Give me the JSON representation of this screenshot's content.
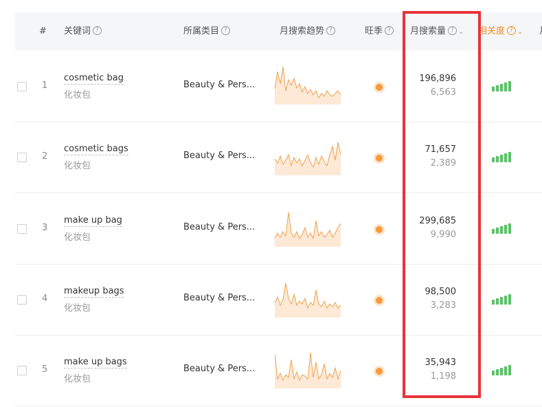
{
  "header": {
    "index": "#",
    "keyword": "关键词",
    "category": "所属类目",
    "trend": "月搜索趋势",
    "season": "旺季",
    "monthly_volume": "月搜索量",
    "relevance": "相关度",
    "next_col": "月",
    "help_icon": "?"
  },
  "rows": [
    {
      "index": "1",
      "keyword": "cosmetic bag",
      "keyword_cn": "化妆包",
      "category": "Beauty & Pers...",
      "volume": "196,896",
      "volume_sub": "6,563",
      "relevance_level": 5,
      "trend": [
        22,
        48,
        30,
        55,
        20,
        36,
        28,
        38,
        24,
        30,
        18,
        26,
        16,
        22,
        14,
        20,
        10,
        16,
        12,
        20,
        14,
        12,
        16,
        20,
        14
      ]
    },
    {
      "index": "2",
      "keyword": "cosmetic bags",
      "keyword_cn": "化妆包",
      "category": "Beauty & Pers...",
      "volume": "71,657",
      "volume_sub": "2,389",
      "relevance_level": 5,
      "trend": [
        24,
        18,
        28,
        16,
        22,
        30,
        14,
        26,
        18,
        24,
        14,
        22,
        30,
        18,
        12,
        26,
        16,
        28,
        20,
        14,
        30,
        42,
        22,
        48,
        30
      ]
    },
    {
      "index": "3",
      "keyword": "make up bag",
      "keyword_cn": "化妆包",
      "category": "Beauty & Pers...",
      "volume": "299,685",
      "volume_sub": "9,990",
      "relevance_level": 5,
      "trend": [
        12,
        20,
        14,
        22,
        16,
        50,
        20,
        14,
        22,
        12,
        18,
        28,
        14,
        20,
        12,
        38,
        16,
        22,
        14,
        18,
        24,
        14,
        20,
        28,
        34
      ]
    },
    {
      "index": "4",
      "keyword": "makeup bags",
      "keyword_cn": "化妆包",
      "category": "Beauty & Pers...",
      "volume": "98,500",
      "volume_sub": "3,283",
      "relevance_level": 5,
      "trend": [
        22,
        30,
        18,
        26,
        50,
        28,
        20,
        34,
        18,
        24,
        20,
        28,
        14,
        22,
        18,
        40,
        20,
        16,
        24,
        14,
        20,
        16,
        22,
        14,
        18
      ]
    },
    {
      "index": "5",
      "keyword": "make up bags",
      "keyword_cn": "化妆包",
      "category": "Beauty & Pers...",
      "volume": "35,943",
      "volume_sub": "1,198",
      "relevance_level": 5,
      "trend": [
        50,
        14,
        22,
        12,
        20,
        16,
        42,
        14,
        24,
        12,
        20,
        18,
        14,
        52,
        16,
        38,
        14,
        20,
        36,
        14,
        22,
        16,
        30,
        14,
        26
      ]
    }
  ],
  "colors": {
    "accent": "#f08a24",
    "trend_line": "#f0a04a",
    "trend_fill": "#fde9d6",
    "highlight": "#e8333a",
    "relevance": "#5cc16a"
  }
}
